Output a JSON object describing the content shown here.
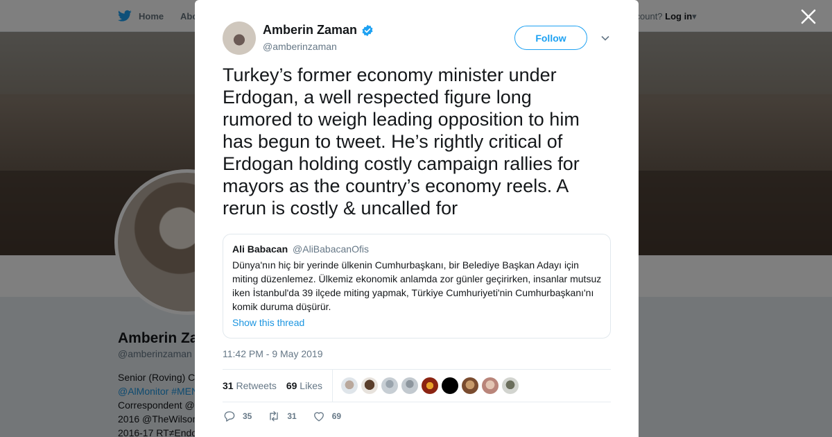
{
  "nav": {
    "home_label": "Home",
    "about_label": "Abo",
    "account_prompt": "ccount?",
    "login_label": "Log in"
  },
  "profile_bg": {
    "name": "Amberin Za",
    "handle": "@amberinzaman",
    "bio_lines": [
      "Senior (Roving) C",
      "@AlMonitor #MEN",
      "Correspondent @",
      "2016 @TheWilson",
      "2016-17 RT≠Endo"
    ]
  },
  "tweet": {
    "author_name": "Amberin Zaman",
    "author_handle": "@amberinzaman",
    "follow_label": "Follow",
    "text": "Turkey’s former economy minister under Erdogan, a well respected figure long rumored to weigh leading opposition to him has begun to tweet. He’s rightly critical of Erdogan holding costly campaign rallies for mayors as the country’s economy reels. A rerun is costly & uncalled for",
    "quote": {
      "name": "Ali Babacan",
      "handle": "@AliBabacanOfis",
      "text": "Dünya'nın hiç bir yerinde ülkenin Cumhurbaşkanı, bir Belediye Başkan Adayı için miting düzenlemez. Ülkemiz ekonomik anlamda zor günler geçirirken, insanlar mutsuz iken İstanbul'da 39 ilçede miting yapmak, Türkiye Cumhuriyeti'nin Cumhurbaşkanı'nı komik duruma düşürür.",
      "show_thread": "Show this thread"
    },
    "timestamp": "11:42 PM - 9 May 2019",
    "retweets_count": "31",
    "retweets_label": "Retweets",
    "likes_count": "69",
    "likes_label": "Likes",
    "actions": {
      "replies": "35",
      "retweets": "31",
      "likes": "69"
    }
  },
  "colors": {
    "accent": "#1da1f2",
    "link": "#1b95e0",
    "muted": "#657786",
    "text": "#14171a"
  },
  "icons": [
    "twitter-bird-icon",
    "close-icon",
    "verified-badge-icon",
    "chevron-down-icon",
    "reply-icon",
    "retweet-icon",
    "like-icon"
  ]
}
